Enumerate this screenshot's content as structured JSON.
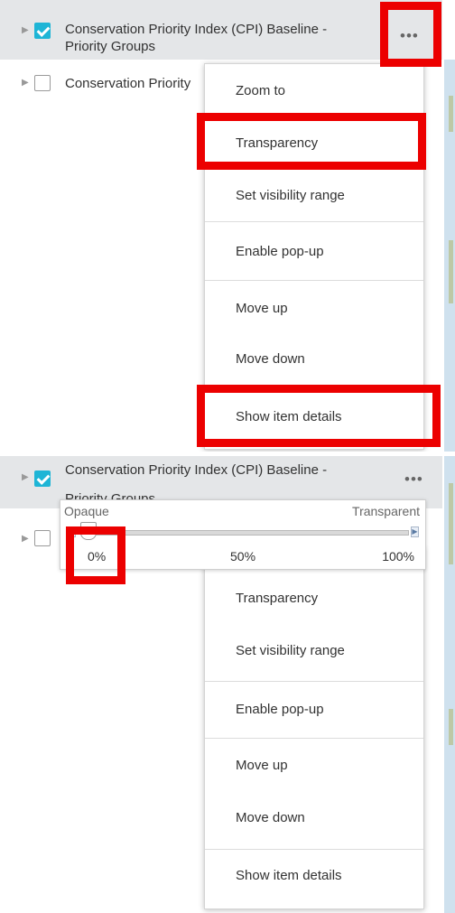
{
  "top": {
    "layers": [
      {
        "title": "Conservation Priority Index (CPI) Baseline - Priority Groups",
        "checked": true
      },
      {
        "title": "Conservation Priority",
        "checked": false
      }
    ],
    "options_icon": "more-horizontal-icon",
    "menu": [
      "Zoom to",
      "Transparency",
      "Set visibility range",
      "Enable pop-up",
      "Move up",
      "Move down",
      "Show item details"
    ]
  },
  "bottom": {
    "layer_title": "Conservation Priority Index (CPI) Baseline -",
    "layer_title_partial": "Priority Groups",
    "slider": {
      "left_label": "Opaque",
      "right_label": "Transparent",
      "ticks": [
        "0%",
        "50%",
        "100%"
      ],
      "value_percent": 0
    },
    "menu": [
      "Transparency",
      "Set visibility range",
      "Enable pop-up",
      "Move up",
      "Move down",
      "Show item details"
    ]
  },
  "colors": {
    "checkbox_checked": "#1eb5d6",
    "highlight": "#ec0000",
    "selected_row": "#e4e6e8"
  }
}
